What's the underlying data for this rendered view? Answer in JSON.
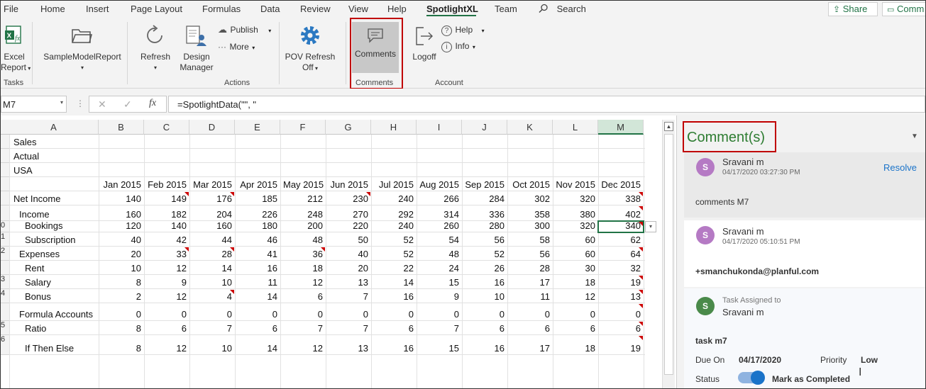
{
  "menu": {
    "items": [
      "File",
      "Home",
      "Insert",
      "Page Layout",
      "Formulas",
      "Data",
      "Review",
      "View",
      "Help",
      "SpotlightXL",
      "Team"
    ],
    "search": "Search",
    "share": "Share",
    "comments_btn": "Comm"
  },
  "ribbon": {
    "excel_report": [
      "Excel",
      "Report"
    ],
    "sample_model": "SampleModelReport",
    "refresh": "Refresh",
    "design_manager": [
      "Design",
      "Manager"
    ],
    "publish": "Publish",
    "more": "More",
    "pov_refresh": [
      "POV Refresh",
      "Off"
    ],
    "comments": "Comments",
    "logoff": "Logoff",
    "help": "Help",
    "info": "Info",
    "groups": {
      "tasks": "Tasks",
      "actions": "Actions",
      "comments": "Comments",
      "account": "Account"
    }
  },
  "formula_bar": {
    "name_box": "M7",
    "formula": "=SpotlightData(\"\", \""
  },
  "grid": {
    "columns": [
      "A",
      "B",
      "C",
      "D",
      "E",
      "F",
      "G",
      "H",
      "I",
      "J",
      "K",
      "L",
      "M"
    ],
    "selected_column": "M",
    "row_numbers": [
      "",
      "",
      "",
      "",
      "",
      "",
      "",
      "",
      "",
      "",
      "0",
      "1",
      "2",
      "",
      "3",
      "4",
      "",
      "5",
      "6"
    ],
    "rows": [
      {
        "label": "Sales",
        "indent": 0,
        "values": []
      },
      {
        "label": "Actual",
        "indent": 0,
        "values": []
      },
      {
        "label": "USA",
        "indent": 0,
        "values": []
      },
      {
        "label": "",
        "indent": 0,
        "values": [
          "Jan 2015",
          "Feb 2015",
          "Mar 2015",
          "Apr 2015",
          "May 2015",
          "Jun 2015",
          "Jul 2015",
          "Aug 2015",
          "Sep 2015",
          "Oct 2015",
          "Nov 2015",
          "Dec 2015"
        ]
      },
      {
        "label": "Net Income",
        "indent": 0,
        "values": [
          "140",
          "149",
          "176",
          "185",
          "212",
          "230",
          "240",
          "266",
          "284",
          "302",
          "320",
          "338"
        ]
      },
      {
        "label": "Income",
        "indent": 1,
        "values": [
          "160",
          "182",
          "204",
          "226",
          "248",
          "270",
          "292",
          "314",
          "336",
          "358",
          "380",
          "402"
        ]
      },
      {
        "label": "Bookings",
        "indent": 2,
        "values": [
          "120",
          "140",
          "160",
          "180",
          "200",
          "220",
          "240",
          "260",
          "280",
          "300",
          "320",
          "340"
        ]
      },
      {
        "label": "Subscription",
        "indent": 2,
        "values": [
          "40",
          "42",
          "44",
          "46",
          "48",
          "50",
          "52",
          "54",
          "56",
          "58",
          "60",
          "62"
        ]
      },
      {
        "label": "Expenses",
        "indent": 1,
        "values": [
          "20",
          "33",
          "28",
          "41",
          "36",
          "40",
          "52",
          "48",
          "52",
          "56",
          "60",
          "64"
        ]
      },
      {
        "label": "Rent",
        "indent": 2,
        "values": [
          "10",
          "12",
          "14",
          "16",
          "18",
          "20",
          "22",
          "24",
          "26",
          "28",
          "30",
          "32"
        ]
      },
      {
        "label": "Salary",
        "indent": 2,
        "values": [
          "8",
          "9",
          "10",
          "11",
          "12",
          "13",
          "14",
          "15",
          "16",
          "17",
          "18",
          "19"
        ]
      },
      {
        "label": "Bonus",
        "indent": 2,
        "values": [
          "2",
          "12",
          "4",
          "14",
          "6",
          "7",
          "16",
          "9",
          "10",
          "11",
          "12",
          "13"
        ]
      },
      {
        "label": "Formula Accounts",
        "indent": 1,
        "values": [
          "0",
          "0",
          "0",
          "0",
          "0",
          "0",
          "0",
          "0",
          "0",
          "0",
          "0",
          "0"
        ]
      },
      {
        "label": "Ratio",
        "indent": 2,
        "values": [
          "8",
          "6",
          "7",
          "6",
          "7",
          "7",
          "6",
          "7",
          "6",
          "6",
          "6",
          "6"
        ]
      },
      {
        "label": "If Then Else",
        "indent": 2,
        "values": [
          "8",
          "12",
          "10",
          "14",
          "12",
          "13",
          "16",
          "15",
          "16",
          "17",
          "18",
          "19"
        ]
      }
    ]
  },
  "panel": {
    "title": "Comment(s)",
    "comment1": {
      "initial": "S",
      "name": "Sravani m",
      "date": "04/17/2020 03:27:30 PM",
      "resolve": "Resolve",
      "text": "comments M7"
    },
    "comment2": {
      "initial": "S",
      "name": "Sravani m",
      "date": "04/17/2020 05:10:51 PM",
      "text": "+smanchukonda@planful.com"
    },
    "task": {
      "initial": "S",
      "assigned_label": "Task Assigned to",
      "name": "Sravani m",
      "title": "task m7",
      "due_label": "Due On",
      "due": "04/17/2020",
      "priority_label": "Priority",
      "priority": "Low",
      "status_label": "Status",
      "status_text": "Mark as Completed"
    },
    "colors": {
      "purple": "#b57ac4",
      "green": "#4a8a4a",
      "accent_green": "#217346",
      "link_blue": "#1a73c9",
      "highlight_red": "#c00000"
    }
  }
}
